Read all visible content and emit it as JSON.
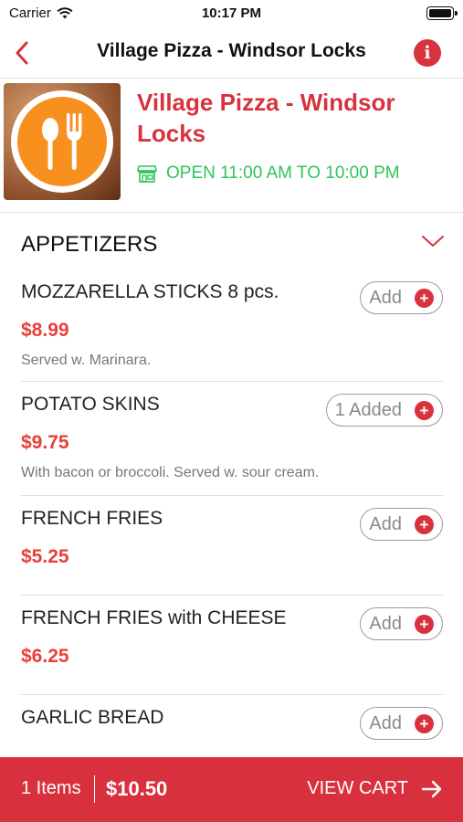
{
  "status": {
    "carrier": "Carrier",
    "time": "10:17 PM"
  },
  "nav": {
    "title": "Village Pizza - Windsor Locks",
    "info_label": "i"
  },
  "restaurant": {
    "name": "Village Pizza - Windsor Locks",
    "hours": "OPEN 11:00 AM TO 10:00 PM"
  },
  "section": {
    "title": "APPETIZERS"
  },
  "items": [
    {
      "name": "MOZZARELLA STICKS 8 pcs.",
      "price": "$8.99",
      "description": "Served w. Marinara.",
      "button": "Add"
    },
    {
      "name": "POTATO SKINS",
      "price": "$9.75",
      "description": "With bacon or broccoli. Served w. sour cream.",
      "button": "1 Added"
    },
    {
      "name": "FRENCH FRIES",
      "price": "$5.25",
      "description": "",
      "button": "Add"
    },
    {
      "name": "FRENCH FRIES with CHEESE",
      "price": "$6.25",
      "description": "",
      "button": "Add"
    },
    {
      "name": "GARLIC BREAD",
      "price": "",
      "description": "",
      "button": "Add"
    }
  ],
  "cart": {
    "items": "1 Items",
    "total": "$10.50",
    "action": "VIEW CART"
  },
  "colors": {
    "brand": "#d8323f",
    "open_green": "#2ec45a",
    "price": "#e8403a"
  },
  "icons": {
    "back": "chevron-left-icon",
    "info": "info-icon",
    "store": "store-icon",
    "collapse": "chevron-down-icon",
    "add": "plus-circle-icon",
    "arrow": "arrow-right-icon"
  }
}
